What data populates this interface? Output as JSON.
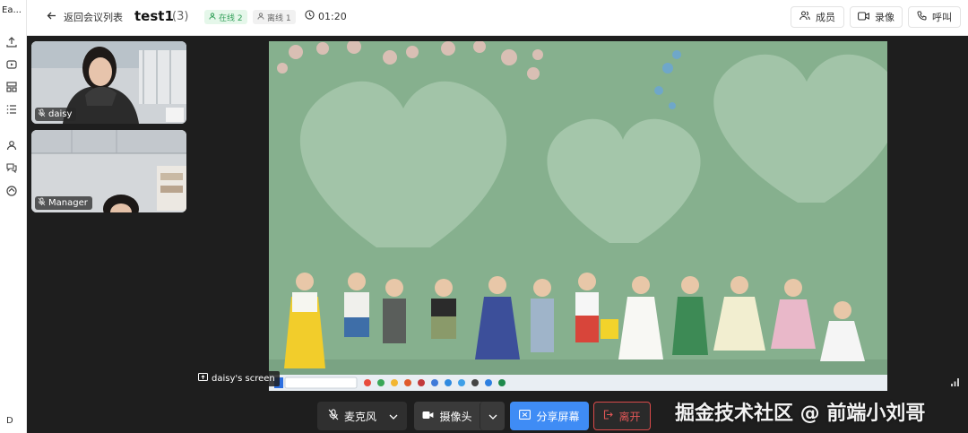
{
  "app": {
    "logo_text": "Ea..."
  },
  "rail": {
    "avatar_initial": "D"
  },
  "header": {
    "back_label": "返回会议列表",
    "meeting_title": "test1",
    "participant_count": "(3)",
    "online_badge": "在线 2",
    "offline_badge": "离线 1",
    "timer": "01:20",
    "members_label": "成员",
    "record_label": "录像",
    "call_label": "呼叫"
  },
  "participants": [
    {
      "name": "daisy"
    },
    {
      "name": "Manager"
    }
  ],
  "share": {
    "label": "daisy's screen"
  },
  "controls": {
    "mic_label": "麦克风",
    "camera_label": "摄像头",
    "share_label": "分享屏幕",
    "leave_label": "离开"
  },
  "watermark": "掘金技术社区 @ 前端小刘哥",
  "colors": {
    "accent": "#3f8cf5",
    "leave": "#e05656",
    "online": "#2f9e57",
    "stage_bg": "#1e1e1e",
    "shared_bg": "#86b08e"
  }
}
